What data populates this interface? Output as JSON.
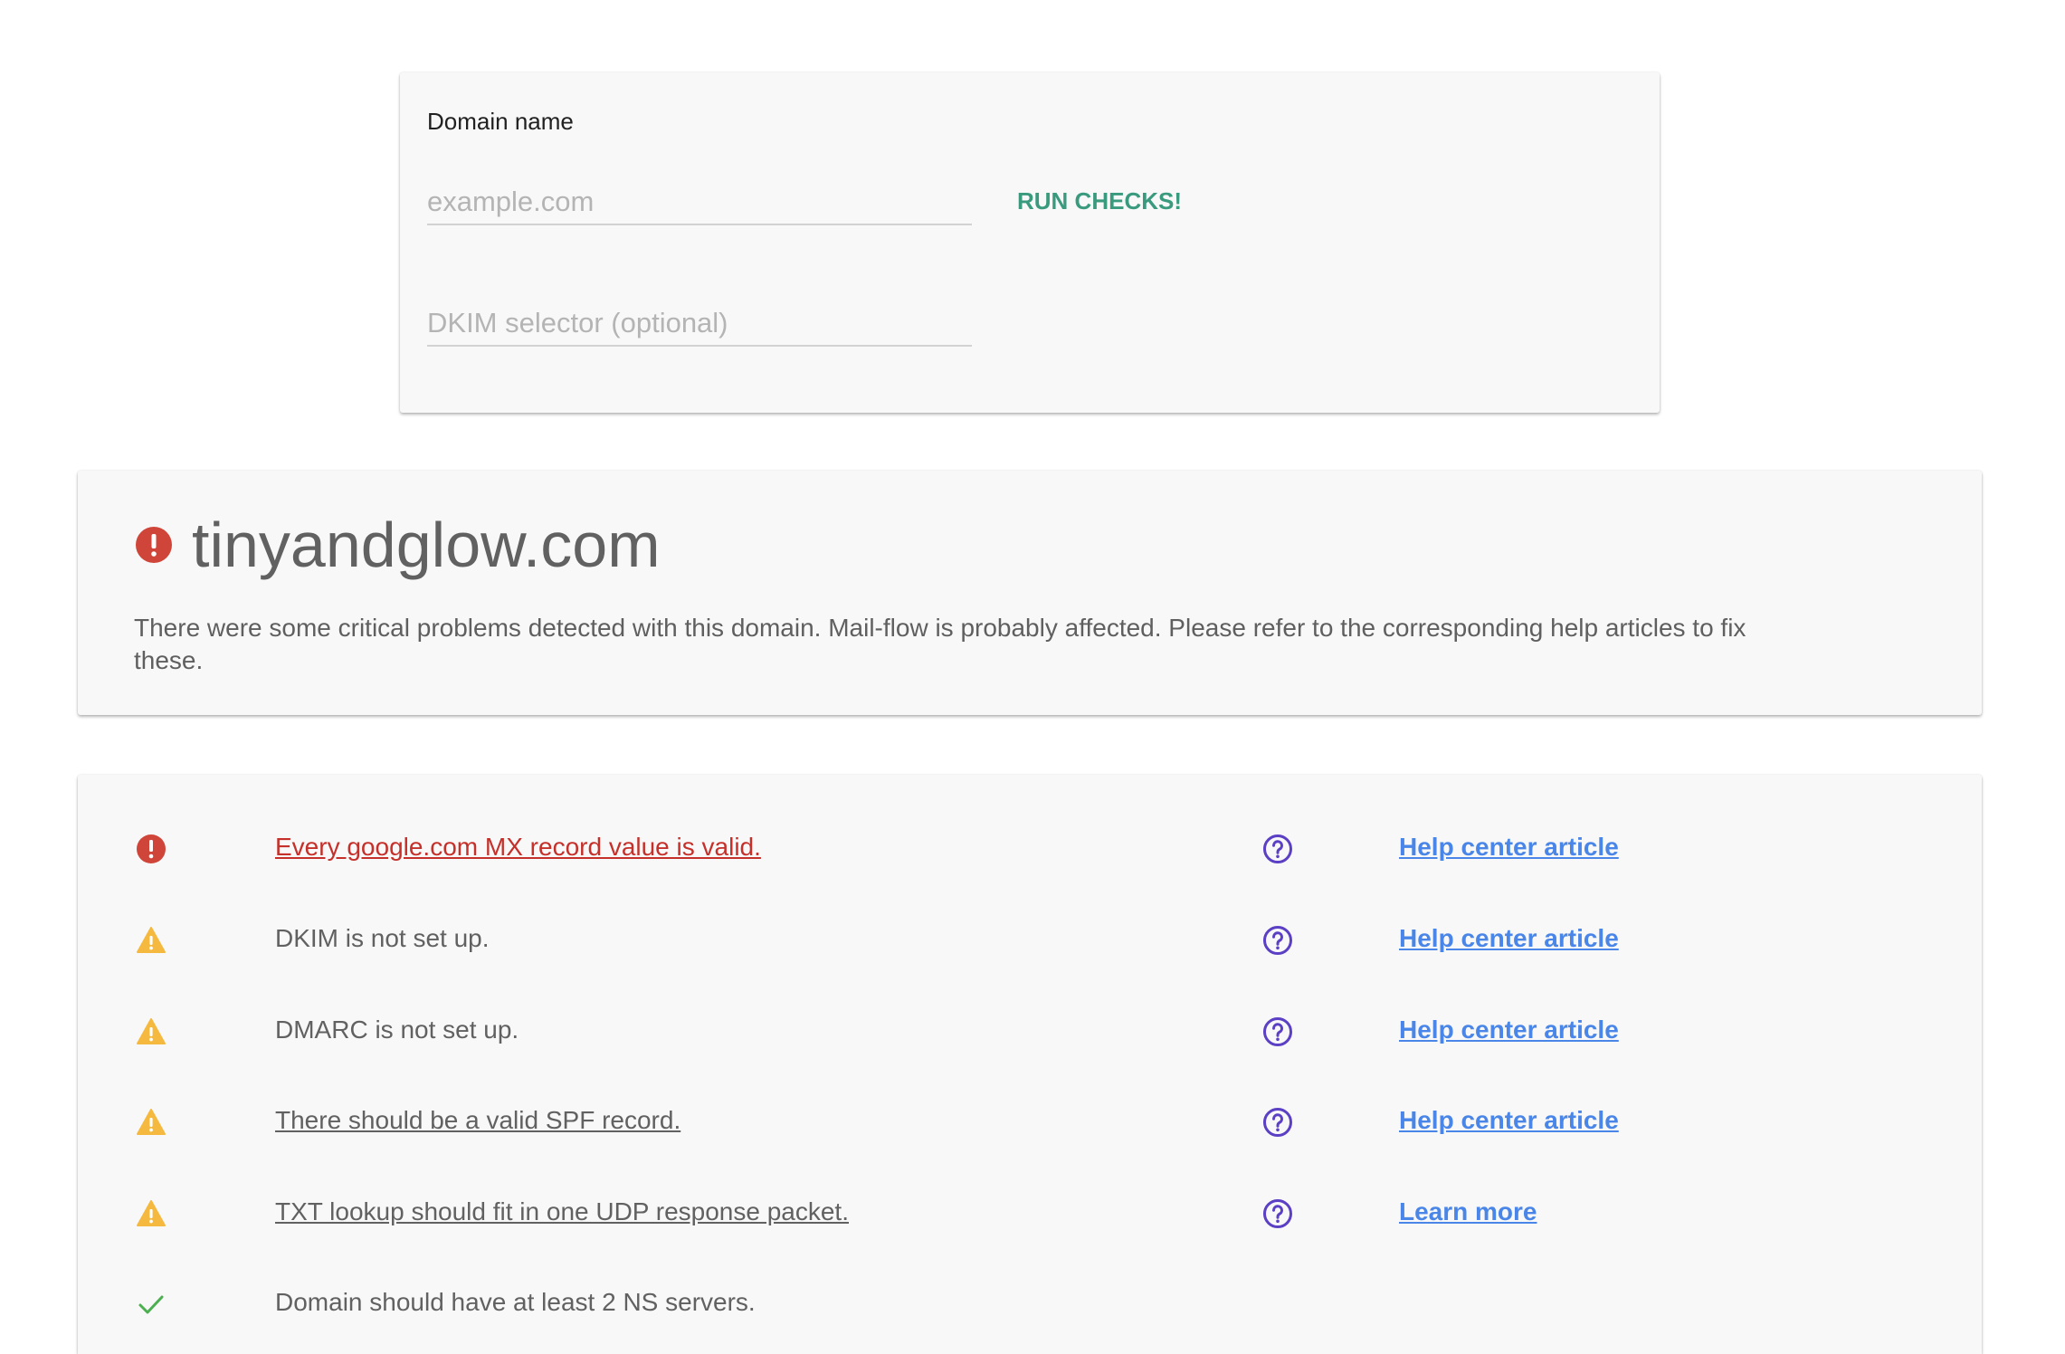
{
  "form": {
    "domain_label": "Domain name",
    "domain_placeholder": "example.com",
    "domain_value": "",
    "dkim_placeholder": "DKIM selector (optional)",
    "dkim_value": "",
    "run_button_label": "RUN CHECKS!"
  },
  "summary": {
    "status": "critical",
    "domain": "tinyandglow.com",
    "message": "There were some critical problems detected with this domain. Mail-flow is probably affected. Please refer to the corresponding help articles to fix these."
  },
  "results": [
    {
      "status": "critical",
      "status_icon": "error-icon",
      "text": "Every google.com MX record value is valid.",
      "is_link": true,
      "help_icon": "help-circle-icon",
      "link_label": "Help center article"
    },
    {
      "status": "warning",
      "status_icon": "warning-icon",
      "text": "DKIM is not set up.",
      "is_link": false,
      "help_icon": "help-circle-icon",
      "link_label": "Help center article"
    },
    {
      "status": "warning",
      "status_icon": "warning-icon",
      "text": "DMARC is not set up.",
      "is_link": false,
      "help_icon": "help-circle-icon",
      "link_label": "Help center article"
    },
    {
      "status": "warning",
      "status_icon": "warning-icon",
      "text": "There should be a valid SPF record.",
      "is_link": true,
      "help_icon": "help-circle-icon",
      "link_label": "Help center article"
    },
    {
      "status": "warning",
      "status_icon": "warning-icon",
      "text": "TXT lookup should fit in one UDP response packet.",
      "is_link": true,
      "help_icon": "help-circle-icon",
      "link_label": "Learn more"
    },
    {
      "status": "pass",
      "status_icon": "check-icon",
      "text": "Domain should have at least 2 NS servers.",
      "is_link": false,
      "help_icon": "",
      "link_label": ""
    }
  ],
  "colors": {
    "critical": "#d04539",
    "warning": "#f4b93e",
    "pass": "#4caf50",
    "help_icon": "#5b3fc4",
    "link": "#4a86e8",
    "accent": "#3a9a7e"
  }
}
